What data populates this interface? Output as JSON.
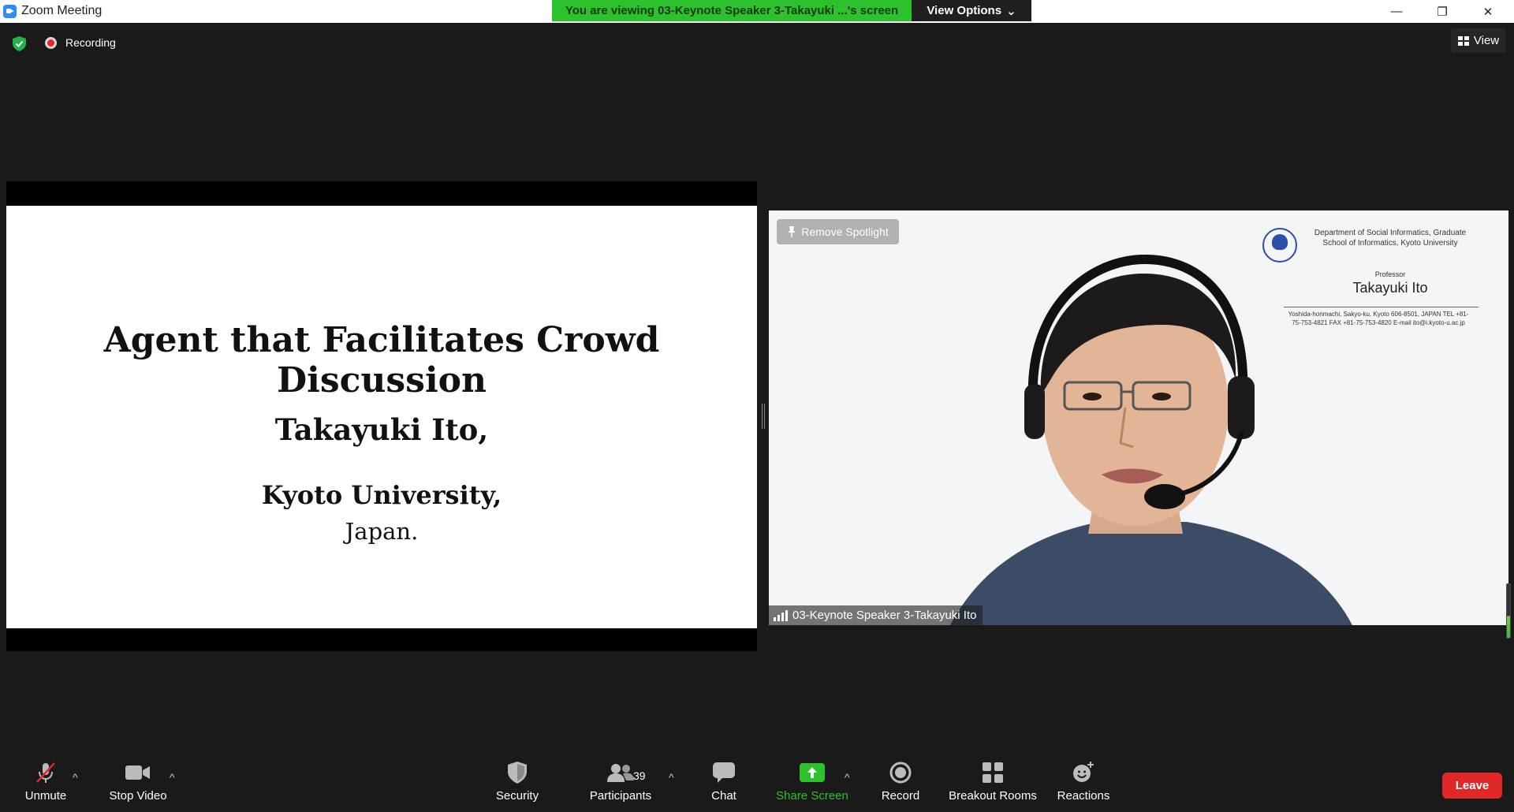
{
  "window": {
    "title": "Zoom Meeting",
    "controls": [
      "—",
      "❐",
      "✕"
    ]
  },
  "banner": {
    "viewing_text": "You are viewing 03-Keynote Speaker 3-Takayuki ...'s screen",
    "view_options_label": "View Options",
    "view_options_caret": "⌄"
  },
  "status": {
    "recording_label": "Recording"
  },
  "view_button": {
    "label": "View"
  },
  "slide": {
    "title": "Agent that Facilitates Crowd Discussion",
    "author": "Takayuki Ito,",
    "affiliation": "Kyoto University,",
    "country": "Japan."
  },
  "video": {
    "remove_spotlight_label": "Remove Spotlight",
    "participant_name": "03-Keynote Speaker 3-Takayuki Ito",
    "background_card": {
      "dept_lines": "Department of Social Informatics, Graduate School of Informatics, Kyoto University",
      "role": "Professor",
      "name": "Takayuki Ito",
      "address": "Yoshida-honmachi, Sakyo-ku, Kyoto 606-8501, JAPAN TEL +81-75-753-4821 FAX +81-75-753-4820 E-mail ito@i.kyoto-u.ac.jp"
    }
  },
  "toolbar": {
    "unmute": "Unmute",
    "stop_video": "Stop Video",
    "security": "Security",
    "participants": "Participants",
    "participants_count": "39",
    "chat": "Chat",
    "share_screen": "Share Screen",
    "record": "Record",
    "breakout_rooms": "Breakout Rooms",
    "reactions": "Reactions",
    "leave": "Leave",
    "caret": "^"
  },
  "colors": {
    "banner_green": "#2ec12e",
    "leave_red": "#e02828",
    "zoom_blue": "#2d8cff"
  }
}
